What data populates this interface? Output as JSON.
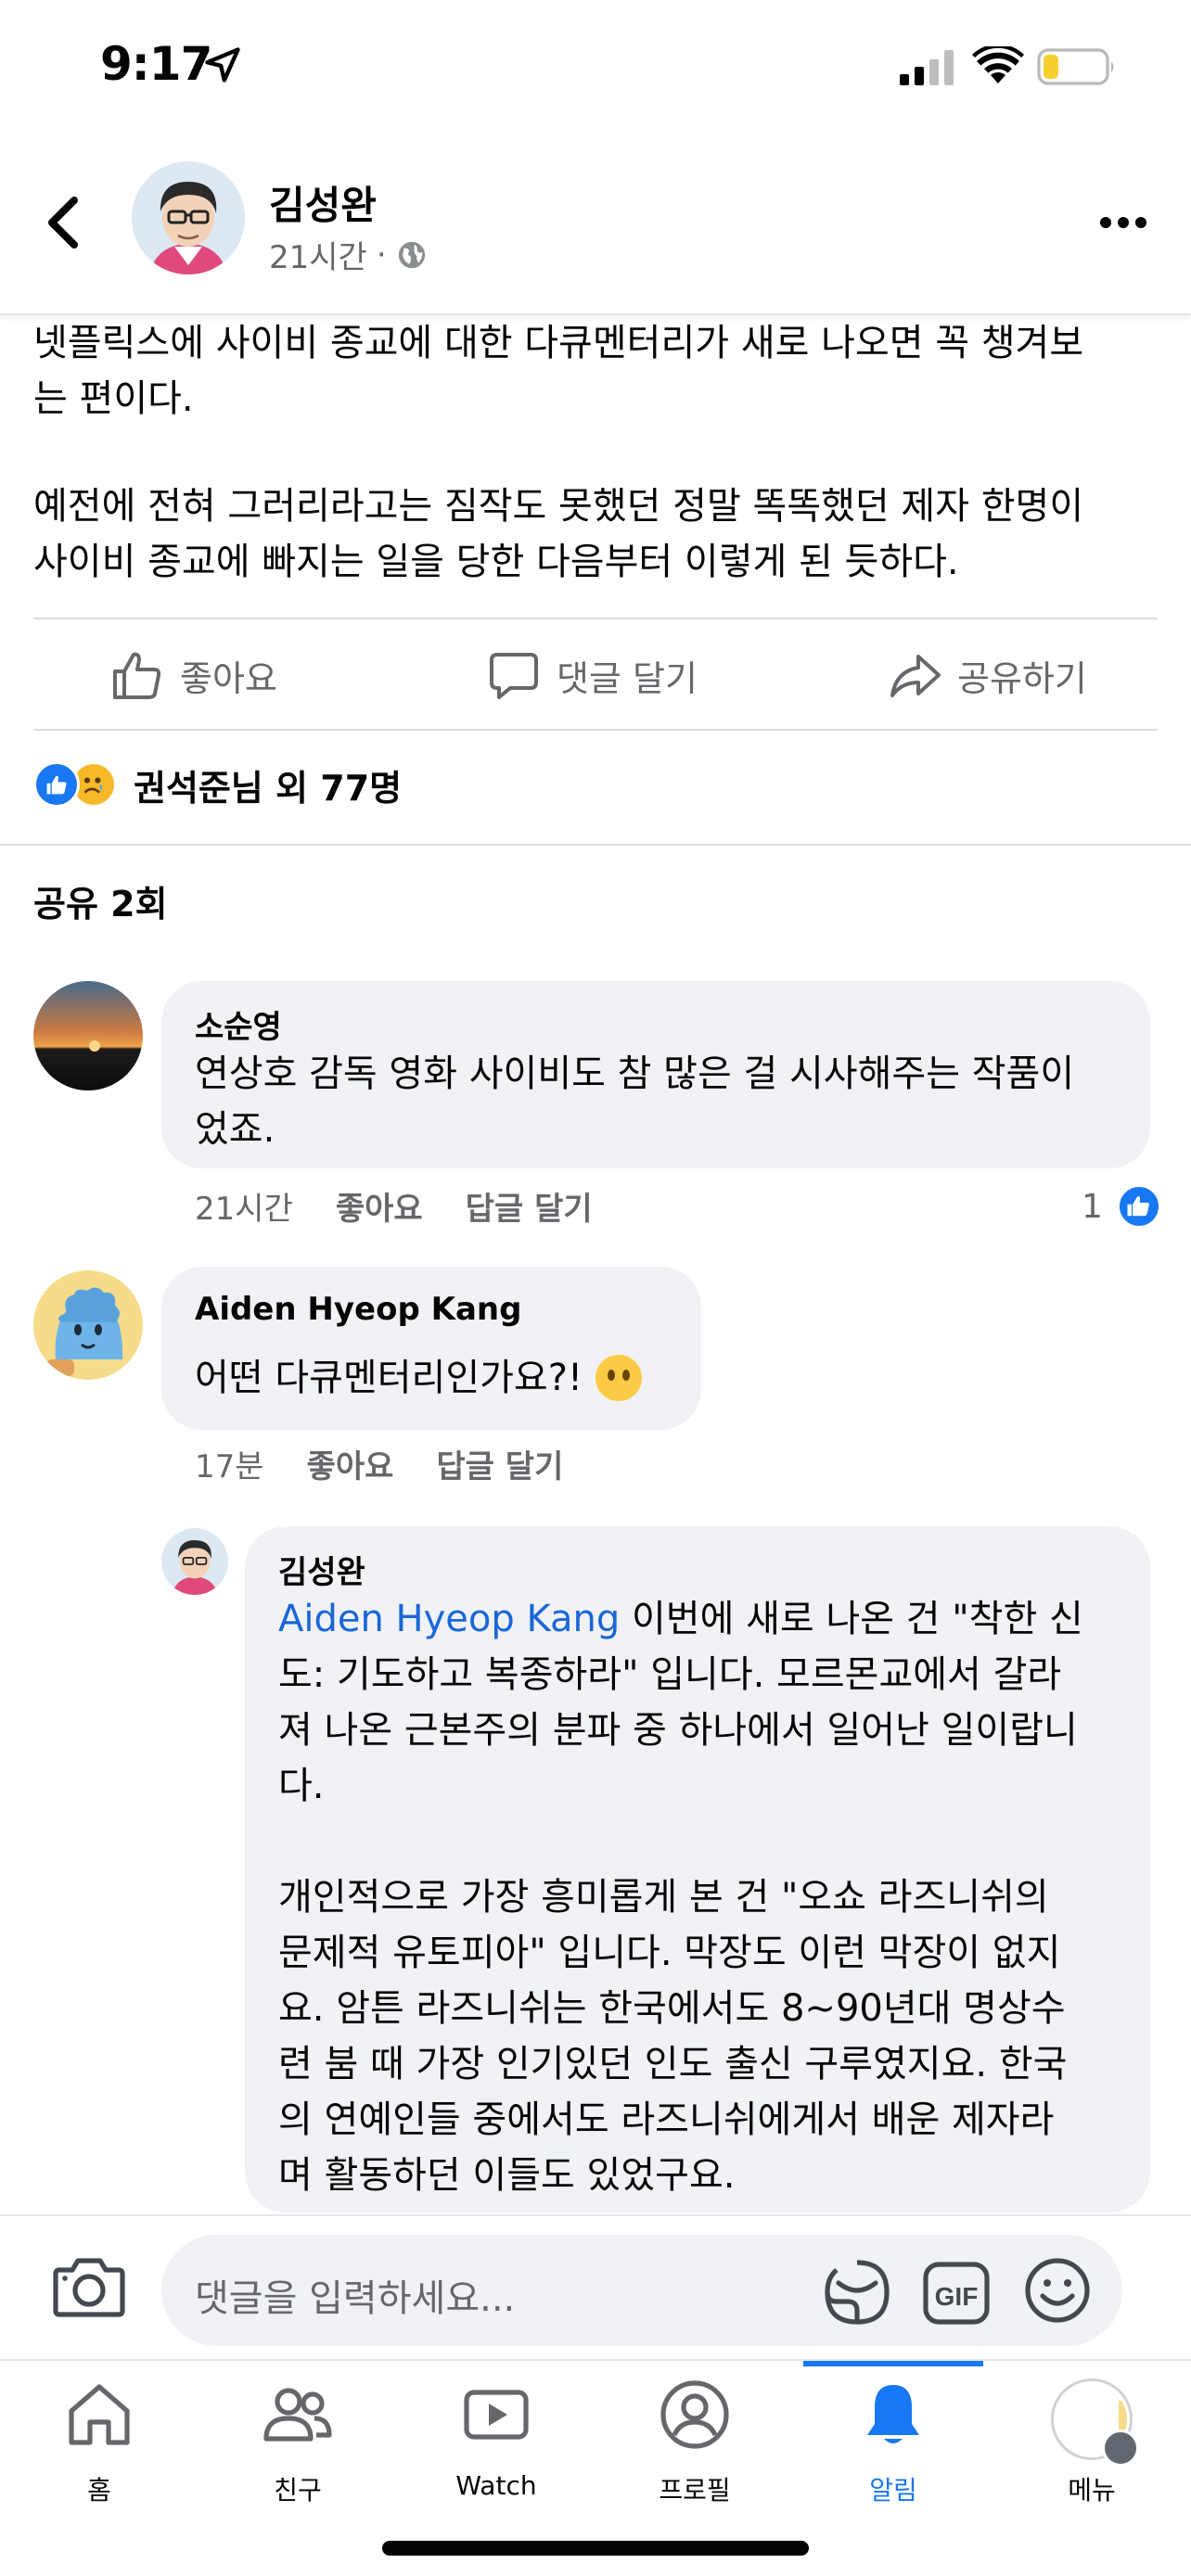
{
  "status_bar": {
    "time": "9:17"
  },
  "header": {
    "author": "김성완",
    "time": "21시간",
    "separator": "·",
    "back_icon": "chevron-left-icon",
    "more_icon": "more-horizontal-icon",
    "privacy_icon": "globe-icon"
  },
  "post": {
    "paragraph_1_line_1": "넷플릭스에 사이비 종교에 대한 다큐멘터리가 새로 나오면 꼭 챙겨보",
    "paragraph_1_line_2": "는 편이다.",
    "paragraph_2_line_1": "예전에 전혀 그러리라고는 짐작도 못했던 정말 똑똑했던 제자 한명이",
    "paragraph_2_line_2": "사이비 종교에 빠지는 일을 당한 다음부터 이렇게 된 듯하다."
  },
  "actions": {
    "like": "좋아요",
    "comment": "댓글 달기",
    "share": "공유하기"
  },
  "reactions": {
    "summary": "권석준님 외 77명"
  },
  "shares": "공유 2회",
  "comments": [
    {
      "name": "소순영",
      "line_1": "연상호 감독 영화 사이비도 참 많은 걸 시사해주는 작품이",
      "line_2": "었죠.",
      "time": "21시간",
      "like": "좋아요",
      "reply": "답글 달기",
      "like_count": "1"
    },
    {
      "name": "Aiden Hyeop Kang",
      "text": "어떤 다큐멘터리인가요?!",
      "time": "17분",
      "like": "좋아요",
      "reply": "답글 달기"
    }
  ],
  "reply": {
    "name": "김성완",
    "mention": "Aiden Hyeop Kang",
    "l1": " 이번에 새로 나온 건 \"착한 신",
    "l2": "도: 기도하고 복종하라\" 입니다. 모르몬교에서 갈라",
    "l3": "져 나온 근본주의 분파 중 하나에서 일어난 일이랍니",
    "l4": "다.",
    "l5": "개인적으로 가장 흥미롭게 본 건 \"오쇼 라즈니쉬의",
    "l6": "문제적 유토피아\" 입니다. 막장도 이런 막장이 없지",
    "l7": "요. 암튼 라즈니쉬는 한국에서도 8~90년대 명상수",
    "l8": "련 붐 때 가장 인기있던 인도 출신 구루였지요. 한국",
    "l9": "의 연예인들 중에서도 라즈니쉬에게서 배운 제자라",
    "l10": "며 활동하던 이들도 있었구요."
  },
  "comment_input": {
    "placeholder": "댓글을 입력하세요..."
  },
  "tabs": [
    {
      "label": "홈",
      "icon": "home-icon"
    },
    {
      "label": "친구",
      "icon": "friends-icon"
    },
    {
      "label": "Watch",
      "icon": "watch-icon"
    },
    {
      "label": "프로필",
      "icon": "profile-icon"
    },
    {
      "label": "알림",
      "icon": "bell-icon",
      "active": true
    },
    {
      "label": "메뉴",
      "icon": "menu-avatar"
    }
  ],
  "colors": {
    "accent": "#1877f2",
    "bubble": "#f0f2f5",
    "secondary_text": "#65676b",
    "mention": "#1a66d8"
  }
}
